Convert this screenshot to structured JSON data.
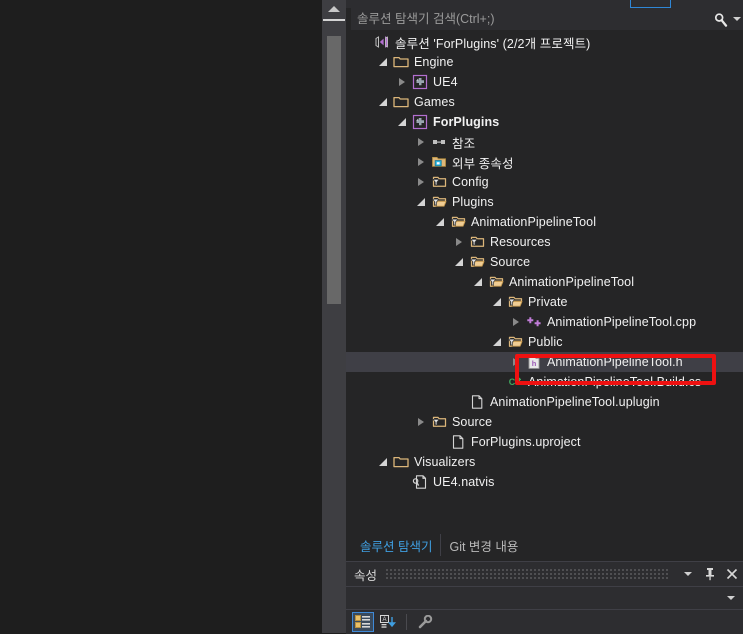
{
  "window": {
    "tool_window_title": "솔루션 탐색기"
  },
  "search": {
    "placeholder": "솔루션 탐색기 검색(Ctrl+;)",
    "value": "",
    "icon": "search-icon",
    "dropdown_icon": "chevron-down-icon"
  },
  "scrollbar": {
    "up_arrow_icon": "scroll-up-arrow-icon"
  },
  "tree": {
    "items": [
      {
        "label": "솔루션 'ForPlugins' (2/2개 프로젝트)",
        "depth": 0,
        "expander": "none",
        "icon": "visual-studio-solution-icon",
        "bold": false,
        "selected": false
      },
      {
        "label": "Engine",
        "depth": 1,
        "expander": "expanded",
        "icon": "folder-icon",
        "bold": false,
        "selected": false
      },
      {
        "label": "UE4",
        "depth": 2,
        "expander": "collapsed",
        "icon": "cpp-project-icon",
        "bold": false,
        "selected": false
      },
      {
        "label": "Games",
        "depth": 1,
        "expander": "expanded",
        "icon": "folder-icon",
        "bold": false,
        "selected": false
      },
      {
        "label": "ForPlugins",
        "depth": 2,
        "expander": "expanded",
        "icon": "cpp-project-icon",
        "bold": true,
        "selected": false
      },
      {
        "label": "참조",
        "depth": 3,
        "expander": "collapsed",
        "icon": "references-icon",
        "bold": false,
        "selected": false
      },
      {
        "label": "외부 종속성",
        "depth": 3,
        "expander": "collapsed",
        "icon": "external-dependencies-icon",
        "bold": false,
        "selected": false
      },
      {
        "label": "Config",
        "depth": 3,
        "expander": "collapsed",
        "icon": "filter-folder-icon",
        "bold": false,
        "selected": false
      },
      {
        "label": "Plugins",
        "depth": 3,
        "expander": "expanded",
        "icon": "filter-folder-open-icon",
        "bold": false,
        "selected": false
      },
      {
        "label": "AnimationPipelineTool",
        "depth": 4,
        "expander": "expanded",
        "icon": "filter-folder-open-icon",
        "bold": false,
        "selected": false
      },
      {
        "label": "Resources",
        "depth": 5,
        "expander": "collapsed",
        "icon": "filter-folder-icon",
        "bold": false,
        "selected": false
      },
      {
        "label": "Source",
        "depth": 5,
        "expander": "expanded",
        "icon": "filter-folder-open-icon",
        "bold": false,
        "selected": false
      },
      {
        "label": "AnimationPipelineTool",
        "depth": 6,
        "expander": "expanded",
        "icon": "filter-folder-open-icon",
        "bold": false,
        "selected": false
      },
      {
        "label": "Private",
        "depth": 7,
        "expander": "expanded",
        "icon": "filter-folder-open-icon",
        "bold": false,
        "selected": false
      },
      {
        "label": "AnimationPipelineTool.cpp",
        "depth": 8,
        "expander": "collapsed",
        "icon": "cpp-file-icon",
        "bold": false,
        "selected": false
      },
      {
        "label": "Public",
        "depth": 7,
        "expander": "expanded",
        "icon": "filter-folder-open-icon",
        "bold": false,
        "selected": false
      },
      {
        "label": "AnimationPipelineTool.h",
        "depth": 8,
        "expander": "collapsed",
        "icon": "header-file-icon",
        "bold": false,
        "selected": true
      },
      {
        "label": "AnimationPipelineTool.Build.cs",
        "depth": 7,
        "expander": "none",
        "icon": "csharp-file-icon",
        "bold": false,
        "selected": false
      },
      {
        "label": "AnimationPipelineTool.uplugin",
        "depth": 5,
        "expander": "none",
        "icon": "generic-file-icon",
        "bold": false,
        "selected": false
      },
      {
        "label": "Source",
        "depth": 3,
        "expander": "collapsed",
        "icon": "filter-folder-icon",
        "bold": false,
        "selected": false
      },
      {
        "label": "ForPlugins.uproject",
        "depth": 4,
        "expander": "none",
        "icon": "generic-file-icon",
        "bold": false,
        "selected": false
      },
      {
        "label": "Visualizers",
        "depth": 1,
        "expander": "expanded",
        "icon": "folder-icon",
        "bold": false,
        "selected": false
      },
      {
        "label": "UE4.natvis",
        "depth": 2,
        "expander": "none",
        "icon": "natvis-file-icon",
        "bold": false,
        "selected": false
      }
    ]
  },
  "tabs": {
    "items": [
      {
        "label": "솔루션 탐색기",
        "active": true
      },
      {
        "label": "Git 변경 내용",
        "active": false
      }
    ]
  },
  "properties": {
    "title": "속성",
    "dropdown_icon": "chevron-down-icon",
    "pin_icon": "pin-icon",
    "close_icon": "close-icon",
    "combo_value": "",
    "combo_caret_icon": "chevron-down-icon",
    "toolbar": [
      {
        "icon": "categorized-view-icon",
        "pressed": true
      },
      {
        "icon": "alphabetical-sort-icon",
        "pressed": false
      },
      {
        "icon": "property-pages-icon",
        "pressed": false
      }
    ]
  },
  "annotation": {
    "type": "red-rectangle-highlight",
    "target_label": "AnimationPipelineTool.h",
    "color": "#ee1111"
  },
  "colors": {
    "tool_window_bg": "#252526",
    "editor_bg": "#1e1e1e",
    "chrome_bg": "#2d2d30",
    "selection_bg": "#3f3f46",
    "accent_blue": "#3f9ee0",
    "folder_gold": "#dcb67a",
    "text": "#f1f1f1"
  }
}
